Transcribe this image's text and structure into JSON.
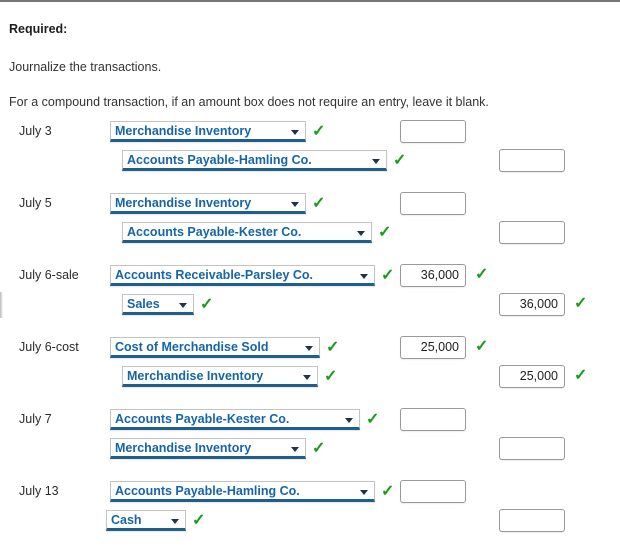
{
  "header": {
    "required_label": "Required:",
    "instruction_1": "Journalize the transactions.",
    "instruction_2": "For a compound transaction, if an amount box does not require an entry, leave it blank."
  },
  "icons": {
    "valid_check": "✓",
    "dropdown_caret": "caret-down"
  },
  "colors": {
    "select_text": "#1565a8",
    "select_underline": "#1f5f8b",
    "check_green": "#1a9b1a",
    "page_background": "#ffffff",
    "amount_border": "#9a9a9a"
  },
  "journal": {
    "entries": [
      {
        "date": "July 3",
        "debit": {
          "account": "Merchandise Inventory",
          "account_valid": "✓",
          "amount": "",
          "amount_valid": ""
        },
        "credit": {
          "account": "Accounts Payable-Hamling Co.",
          "account_valid": "✓",
          "amount": "",
          "amount_valid": ""
        }
      },
      {
        "date": "July 5",
        "debit": {
          "account": "Merchandise Inventory",
          "account_valid": "✓",
          "amount": "",
          "amount_valid": ""
        },
        "credit": {
          "account": "Accounts Payable-Kester Co.",
          "account_valid": "✓",
          "amount": "",
          "amount_valid": ""
        }
      },
      {
        "date": "July 6-sale",
        "debit": {
          "account": "Accounts Receivable-Parsley Co.",
          "account_valid": "✓",
          "amount": "36,000",
          "amount_valid": "✓"
        },
        "credit": {
          "account": "Sales",
          "account_valid": "✓",
          "amount": "36,000",
          "amount_valid": "✓"
        }
      },
      {
        "date": "July 6-cost",
        "debit": {
          "account": "Cost of Merchandise Sold",
          "account_valid": "✓",
          "amount": "25,000",
          "amount_valid": "✓"
        },
        "credit": {
          "account": "Merchandise Inventory",
          "account_valid": "✓",
          "amount": "25,000",
          "amount_valid": "✓"
        }
      },
      {
        "date": "July 7",
        "debit": {
          "account": "Accounts Payable-Kester Co.",
          "account_valid": "✓",
          "amount": "",
          "amount_valid": ""
        },
        "credit": {
          "account": "Merchandise Inventory",
          "account_valid": "✓",
          "amount": "",
          "amount_valid": ""
        }
      },
      {
        "date": "July 13",
        "debit": {
          "account": "Accounts Payable-Hamling Co.",
          "account_valid": "✓",
          "amount": "",
          "amount_valid": ""
        },
        "credit": {
          "account": "Cash",
          "account_valid": "✓",
          "amount": "",
          "amount_valid": ""
        }
      }
    ]
  }
}
